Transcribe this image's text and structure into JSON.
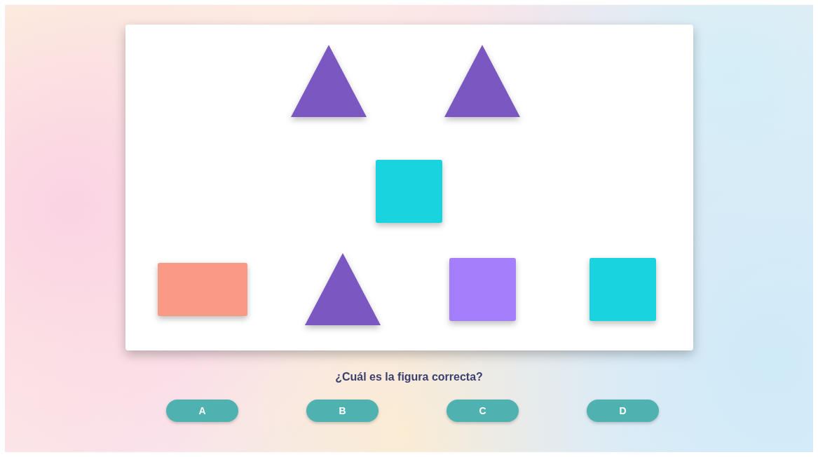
{
  "sequence": [
    {
      "kind": "triangle",
      "color": "#7b57c2"
    },
    {
      "kind": "triangle",
      "color": "#7b57c2"
    },
    {
      "kind": "square",
      "color": "#19d3df"
    }
  ],
  "options": [
    {
      "kind": "rectangle",
      "color": "#f99a86"
    },
    {
      "kind": "triangle",
      "color": "#7b57c2"
    },
    {
      "kind": "square",
      "color": "#a57ffb"
    },
    {
      "kind": "square",
      "color": "#19d3df"
    }
  ],
  "question": "¿Cuál es la figura correcta?",
  "answers": [
    "A",
    "B",
    "C",
    "D"
  ]
}
